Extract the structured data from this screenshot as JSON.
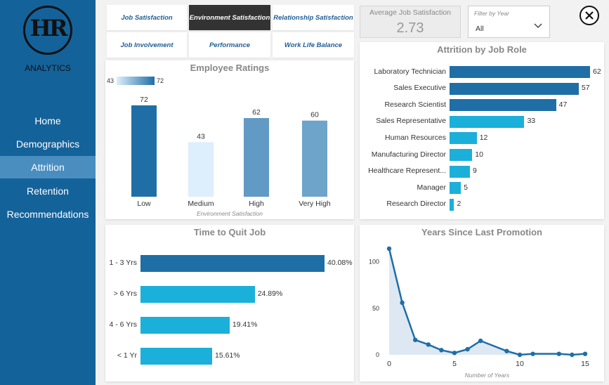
{
  "sidebar": {
    "logo_letters": "HR",
    "logo_text": "ANALYTICS",
    "items": [
      {
        "label": "Home",
        "active": false
      },
      {
        "label": "Demographics",
        "active": false
      },
      {
        "label": "Attrition",
        "active": true
      },
      {
        "label": "Retention",
        "active": false
      },
      {
        "label": "Recommendations",
        "active": false
      }
    ]
  },
  "tabs": [
    {
      "label": "Job Satisfaction",
      "active": false
    },
    {
      "label": "Environment Satisfaction",
      "active": true
    },
    {
      "label": "Relationship Satisfaction",
      "active": false
    },
    {
      "label": "Job Involvement",
      "active": false
    },
    {
      "label": "Performance",
      "active": false
    },
    {
      "label": "Work Life Balance",
      "active": false
    }
  ],
  "kpi": {
    "label": "Average Job Satisfaction",
    "value": "2.73"
  },
  "filter": {
    "label": "Filter by Year",
    "value": "All"
  },
  "colors": {
    "sidebar": "#14629a",
    "dark_blue": "#1f6ea6",
    "cyan": "#1ab0d9",
    "light_blue": "#ddeefc"
  },
  "icons": {
    "close": "close-icon",
    "dropdown": "chevron-down-icon"
  },
  "chart_data": [
    {
      "id": "ratings",
      "type": "bar",
      "title": "Employee Ratings",
      "xlabel": "Environment Satisfaction",
      "categories": [
        "Low",
        "Medium",
        "High",
        "Very High"
      ],
      "values": [
        72,
        43,
        62,
        60
      ],
      "gradient_legend": {
        "min": "43",
        "max": "72"
      },
      "ylim": [
        0,
        80
      ]
    },
    {
      "id": "jobrole",
      "type": "bar",
      "orientation": "horizontal",
      "title": "Attrition by Job Role",
      "categories": [
        "Laboratory Technician",
        "Sales Executive",
        "Research Scientist",
        "Sales Representative",
        "Human Resources",
        "Manufacturing Director",
        "Healthcare Represent...",
        "Manager",
        "Research Director"
      ],
      "values": [
        62,
        57,
        47,
        33,
        12,
        10,
        9,
        5,
        2
      ]
    },
    {
      "id": "quit",
      "type": "bar",
      "orientation": "horizontal",
      "title": "Time to Quit Job",
      "categories": [
        "1 - 3 Yrs",
        "> 6 Yrs",
        "4 - 6 Yrs",
        "< 1 Yr"
      ],
      "values": [
        40.08,
        24.89,
        19.41,
        15.61
      ],
      "value_labels": [
        "40.08%",
        "24.89%",
        "19.41%",
        "15.61%"
      ]
    },
    {
      "id": "promotion",
      "type": "area",
      "title": "Years Since Last Promotion",
      "xlabel": "Number of Years",
      "x": [
        0,
        1,
        2,
        3,
        4,
        5,
        6,
        7,
        9,
        10,
        11,
        13,
        14,
        15
      ],
      "y": [
        114,
        56,
        16,
        11,
        5,
        2,
        6,
        15,
        4,
        0,
        1,
        1,
        0,
        1
      ],
      "xticks": [
        "0",
        "5",
        "10",
        "15"
      ],
      "yticks": [
        "0",
        "50",
        "100"
      ],
      "xlim": [
        0,
        15
      ],
      "ylim": [
        0,
        120
      ]
    }
  ]
}
